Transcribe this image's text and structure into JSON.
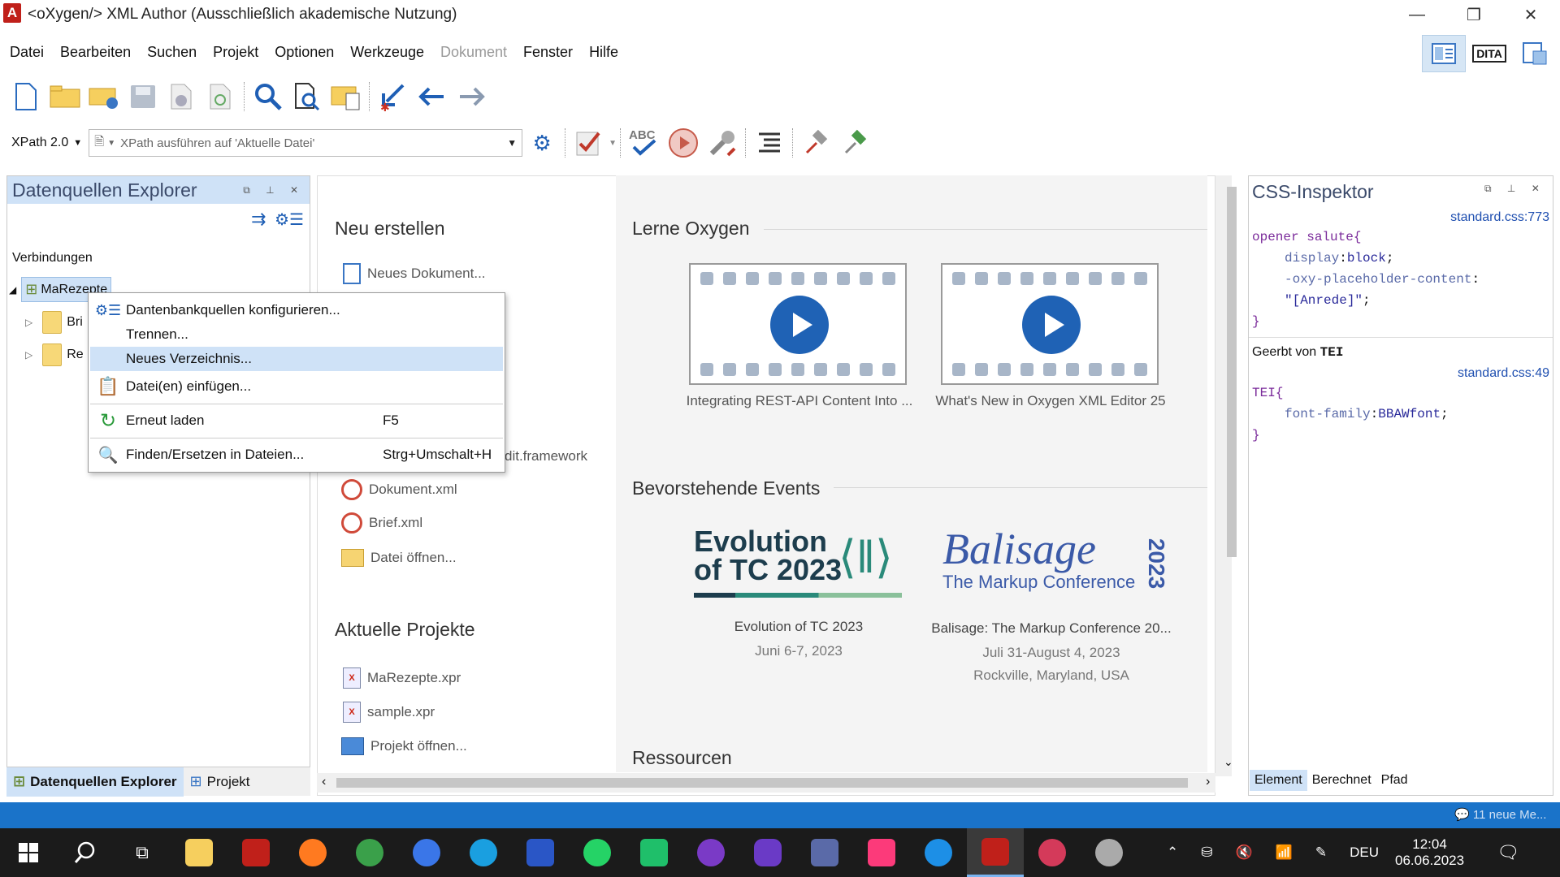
{
  "window": {
    "title": "<oXygen/> XML Author (Ausschließlich akademische Nutzung)",
    "logo": "A",
    "min": "—",
    "max": "❐",
    "close": "✕"
  },
  "menu": [
    {
      "label": "Datei",
      "disabled": false
    },
    {
      "label": "Bearbeiten",
      "disabled": false
    },
    {
      "label": "Suchen",
      "disabled": false
    },
    {
      "label": "Projekt",
      "disabled": false
    },
    {
      "label": "Optionen",
      "disabled": false
    },
    {
      "label": "Werkzeuge",
      "disabled": false
    },
    {
      "label": "Dokument",
      "disabled": true
    },
    {
      "label": "Fenster",
      "disabled": false
    },
    {
      "label": "Hilfe",
      "disabled": false
    }
  ],
  "perspectives": {
    "dita_label": "DITA"
  },
  "xpath": {
    "version": "XPath 2.0",
    "placeholder": "XPath ausführen auf  'Aktuelle Datei'"
  },
  "left_panel": {
    "title": "Datenquellen Explorer",
    "connections_label": "Verbindungen",
    "root_node": "MaRezepte",
    "child1": "Bri",
    "child2": "Re",
    "tabs": [
      "Datenquellen Explorer",
      "Projekt"
    ]
  },
  "context_menu": [
    {
      "label": "Dantenbankquellen konfigurieren...",
      "shortcut": "",
      "icon": "gear-list-icon"
    },
    {
      "label": "Trennen...",
      "shortcut": "",
      "icon": ""
    },
    {
      "label": "Neues Verzeichnis...",
      "shortcut": "",
      "icon": "",
      "highlighted": true
    },
    {
      "label": "Datei(en) einfügen...",
      "shortcut": "",
      "icon": "paste-icon"
    },
    {
      "label": "Erneut laden",
      "shortcut": "F5",
      "icon": "reload-icon"
    },
    {
      "label": "Finden/Ersetzen in Dateien...",
      "shortcut": "Strg+Umschalt+H",
      "icon": "find-replace-icon"
    }
  ],
  "welcome": {
    "new_title": "Neu erstellen",
    "new_doc": "Neues Dokument...",
    "partial_framework": "dit.framework",
    "recent_files": [
      "Dokument.xml",
      "Brief.xml"
    ],
    "open_file": "Datei öffnen...",
    "projects_title": "Aktuelle Projekte",
    "projects": [
      "MaRezepte.xpr",
      "sample.xpr"
    ],
    "open_project": "Projekt öffnen...",
    "learn_title": "Lerne Oxygen",
    "videos": [
      "Integrating REST-API Content Into ...",
      "What's New in Oxygen XML Editor 25"
    ],
    "events_title": "Bevorstehende Events",
    "events": [
      {
        "logo_line1": "Evolution",
        "logo_line2": "of TC 2023",
        "name": "Evolution of TC 2023",
        "date": "Juni 6-7, 2023",
        "place": ""
      },
      {
        "logo_line1": "Balisage",
        "logo_line2": "The Markup Conference",
        "logo_year": "2023",
        "name": "Balisage: The Markup Conference 20...",
        "date": "Juli 31-August 4, 2023",
        "place": "Rockville, Maryland, USA"
      }
    ],
    "resources_title": "Ressourcen"
  },
  "css_inspector": {
    "title": "CSS-Inspektor",
    "src1": "standard.css:773",
    "sel1": "opener salute",
    "brace_open": "{",
    "brace_close": "}",
    "p1_name": "display",
    "p1_val": "block",
    "p2_name": "-oxy-placeholder-content",
    "p2_val": "\"[Anrede]\"",
    "inherited_prefix": "Geerbt von",
    "inherited_el": "TEI",
    "src2": "standard.css:49",
    "sel2": "TEI",
    "p3_name": "font-family",
    "p3_val": "BBAWfont",
    "tabs": [
      "Element",
      "Berechnet",
      "Pfad"
    ]
  },
  "status": {
    "notification": "11 neue Me..."
  },
  "taskbar": {
    "lang": "DEU",
    "time": "12:04",
    "date": "06.06.2023"
  },
  "colors": {
    "accent": "#1f62b5",
    "status_bar": "#1a73c9",
    "panel_header": "#cfe2f7"
  }
}
